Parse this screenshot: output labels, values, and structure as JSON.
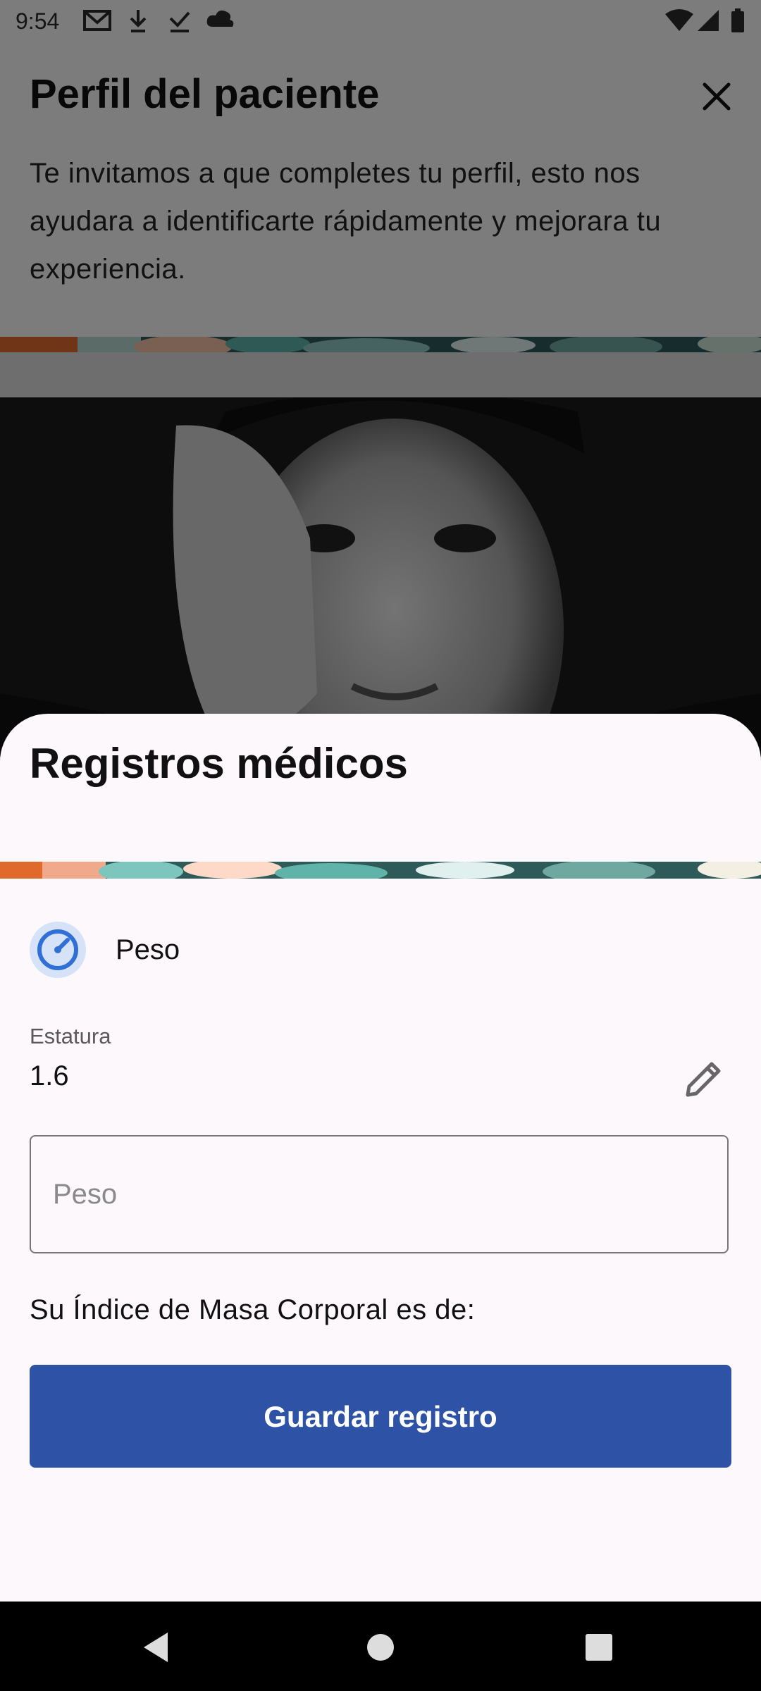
{
  "status_bar": {
    "time": "9:54",
    "icons": [
      "gmail-icon",
      "download-icon",
      "check-icon",
      "cloud-icon",
      "wifi-icon",
      "signal-icon",
      "battery-icon"
    ]
  },
  "header": {
    "title": "Perfil del paciente",
    "description": "Te invitamos a que completes tu perfil, esto nos ayudara a identificarte rápidamente y mejorara tu experiencia."
  },
  "sheet": {
    "title": "Registros médicos",
    "weight_row_label": "Peso",
    "height_caption": "Estatura",
    "height_value": "1.6",
    "weight_input_placeholder": "Peso",
    "weight_input_value": "",
    "bmi_label": "Su Índice de Masa Corporal es de:",
    "save_button_label": "Guardar registro"
  },
  "colors": {
    "primary_button": "#2e52a6",
    "scrim": "rgba(0,0,0,0.5)",
    "sheet_background": "#fdf8fc",
    "icon_circle": "#d5e2f8",
    "icon_accent": "#2f6fd6"
  },
  "nav_bar": {
    "icons": [
      "back-icon",
      "home-icon",
      "recents-icon"
    ]
  }
}
